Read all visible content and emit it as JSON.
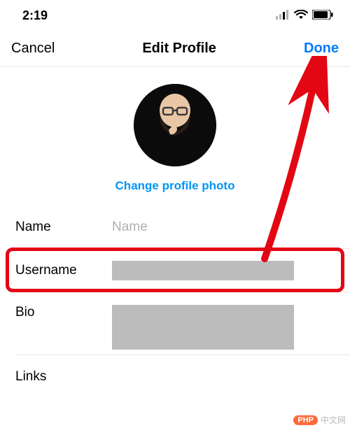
{
  "status_bar": {
    "time": "2:19"
  },
  "nav": {
    "cancel": "Cancel",
    "title": "Edit Profile",
    "done": "Done"
  },
  "profile": {
    "change_photo": "Change profile photo"
  },
  "form": {
    "name": {
      "label": "Name",
      "placeholder": "Name",
      "value": ""
    },
    "username": {
      "label": "Username"
    },
    "bio": {
      "label": "Bio"
    },
    "links": {
      "label": "Links"
    }
  },
  "watermark": {
    "pill": "PHP",
    "text": "中文网"
  },
  "colors": {
    "accent": "#007aff",
    "link": "#0095f6",
    "highlight": "#e30613"
  }
}
